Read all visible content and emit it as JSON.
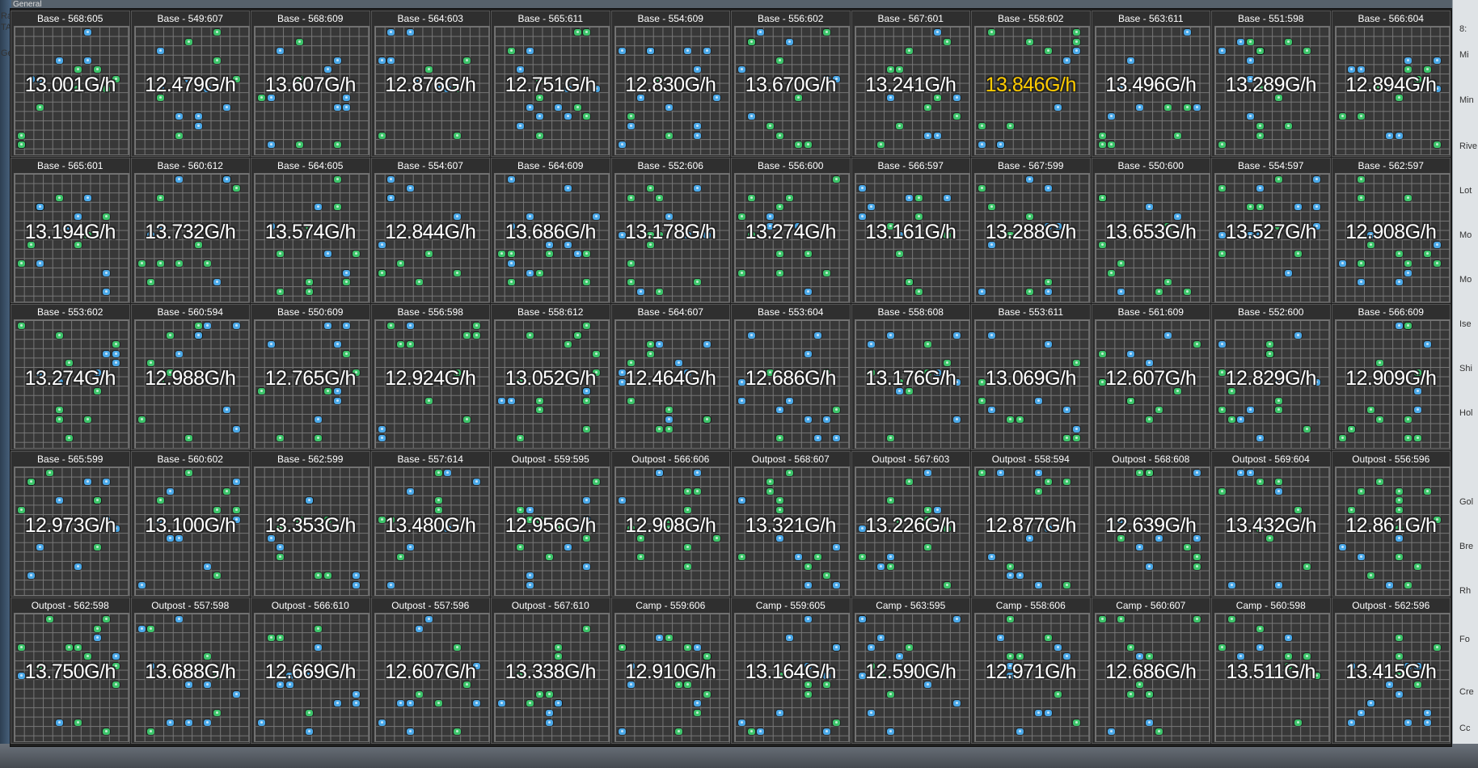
{
  "window": {
    "left_tabs": [
      "Ra",
      "TA",
      "Ge",
      "General"
    ]
  },
  "right_panel": {
    "items": [
      "8:",
      "Mi",
      "Min",
      "Rive",
      "Lot",
      "Mo",
      "Mo",
      "Ise",
      "Shi",
      "Hol",
      "Gol",
      "Bre",
      "Rh",
      "Fo",
      "Cre",
      "Cc"
    ]
  },
  "overlay": {
    "highlight_color": "#ffcc00",
    "node_colors": {
      "blue": "#4aa8e8",
      "green": "#3cc46a"
    },
    "cells": [
      {
        "title": "Base - 568:605",
        "rate": "13.001G/h"
      },
      {
        "title": "Base - 549:607",
        "rate": "12.479G/h"
      },
      {
        "title": "Base - 568:609",
        "rate": "13.607G/h"
      },
      {
        "title": "Base - 564:603",
        "rate": "12.876G/h"
      },
      {
        "title": "Base - 565:611",
        "rate": "12.751G/h"
      },
      {
        "title": "Base - 554:609",
        "rate": "12.830G/h"
      },
      {
        "title": "Base - 556:602",
        "rate": "13.670G/h"
      },
      {
        "title": "Base - 567:601",
        "rate": "13.241G/h"
      },
      {
        "title": "Base - 558:602",
        "rate": "13.846G/h",
        "best": true
      },
      {
        "title": "Base - 563:611",
        "rate": "13.496G/h"
      },
      {
        "title": "Base - 551:598",
        "rate": "13.289G/h"
      },
      {
        "title": "Base - 566:604",
        "rate": "12.894G/h"
      },
      {
        "title": "Base - 565:601",
        "rate": "13.194G/h"
      },
      {
        "title": "Base - 560:612",
        "rate": "13.732G/h"
      },
      {
        "title": "Base - 564:605",
        "rate": "13.574G/h"
      },
      {
        "title": "Base - 554:607",
        "rate": "12.844G/h"
      },
      {
        "title": "Base - 564:609",
        "rate": "13.686G/h"
      },
      {
        "title": "Base - 552:606",
        "rate": "13.178G/h"
      },
      {
        "title": "Base - 556:600",
        "rate": "13.274G/h"
      },
      {
        "title": "Base - 566:597",
        "rate": "13.161G/h"
      },
      {
        "title": "Base - 567:599",
        "rate": "13.288G/h"
      },
      {
        "title": "Base - 550:600",
        "rate": "13.653G/h"
      },
      {
        "title": "Base - 554:597",
        "rate": "13.527G/h"
      },
      {
        "title": "Base - 562:597",
        "rate": "12.908G/h"
      },
      {
        "title": "Base - 553:602",
        "rate": "13.274G/h"
      },
      {
        "title": "Base - 560:594",
        "rate": "12.988G/h"
      },
      {
        "title": "Base - 550:609",
        "rate": "12.765G/h"
      },
      {
        "title": "Base - 556:598",
        "rate": "12.924G/h"
      },
      {
        "title": "Base - 558:612",
        "rate": "13.052G/h"
      },
      {
        "title": "Base - 564:607",
        "rate": "12.464G/h"
      },
      {
        "title": "Base - 553:604",
        "rate": "12.686G/h"
      },
      {
        "title": "Base - 558:608",
        "rate": "13.176G/h"
      },
      {
        "title": "Base - 553:611",
        "rate": "13.069G/h"
      },
      {
        "title": "Base - 561:609",
        "rate": "12.607G/h"
      },
      {
        "title": "Base - 552:600",
        "rate": "12.829G/h"
      },
      {
        "title": "Base - 566:609",
        "rate": "12.909G/h"
      },
      {
        "title": "Base - 565:599",
        "rate": "12.973G/h"
      },
      {
        "title": "Base - 560:602",
        "rate": "13.100G/h"
      },
      {
        "title": "Base - 562:599",
        "rate": "13.353G/h"
      },
      {
        "title": "Base - 557:614",
        "rate": "13.480G/h"
      },
      {
        "title": "Outpost - 559:595",
        "rate": "12.956G/h"
      },
      {
        "title": "Outpost - 566:606",
        "rate": "12.908G/h"
      },
      {
        "title": "Outpost - 568:607",
        "rate": "13.321G/h"
      },
      {
        "title": "Outpost - 567:603",
        "rate": "13.226G/h"
      },
      {
        "title": "Outpost - 558:594",
        "rate": "12.877G/h"
      },
      {
        "title": "Outpost - 568:608",
        "rate": "12.639G/h"
      },
      {
        "title": "Outpost - 569:604",
        "rate": "13.432G/h"
      },
      {
        "title": "Outpost - 556:596",
        "rate": "12.861G/h"
      },
      {
        "title": "Outpost - 562:598",
        "rate": "13.750G/h"
      },
      {
        "title": "Outpost - 557:598",
        "rate": "13.688G/h"
      },
      {
        "title": "Outpost - 566:610",
        "rate": "12.669G/h"
      },
      {
        "title": "Outpost - 557:596",
        "rate": "12.607G/h"
      },
      {
        "title": "Outpost - 567:610",
        "rate": "13.338G/h"
      },
      {
        "title": "Camp - 559:606",
        "rate": "12.910G/h"
      },
      {
        "title": "Camp - 559:605",
        "rate": "13.164G/h"
      },
      {
        "title": "Camp - 563:595",
        "rate": "12.590G/h"
      },
      {
        "title": "Camp - 558:606",
        "rate": "12.971G/h"
      },
      {
        "title": "Camp - 560:607",
        "rate": "12.686G/h"
      },
      {
        "title": "Camp - 560:598",
        "rate": "13.511G/h"
      },
      {
        "title": "Outpost - 562:596",
        "rate": "13.415G/h"
      }
    ]
  }
}
